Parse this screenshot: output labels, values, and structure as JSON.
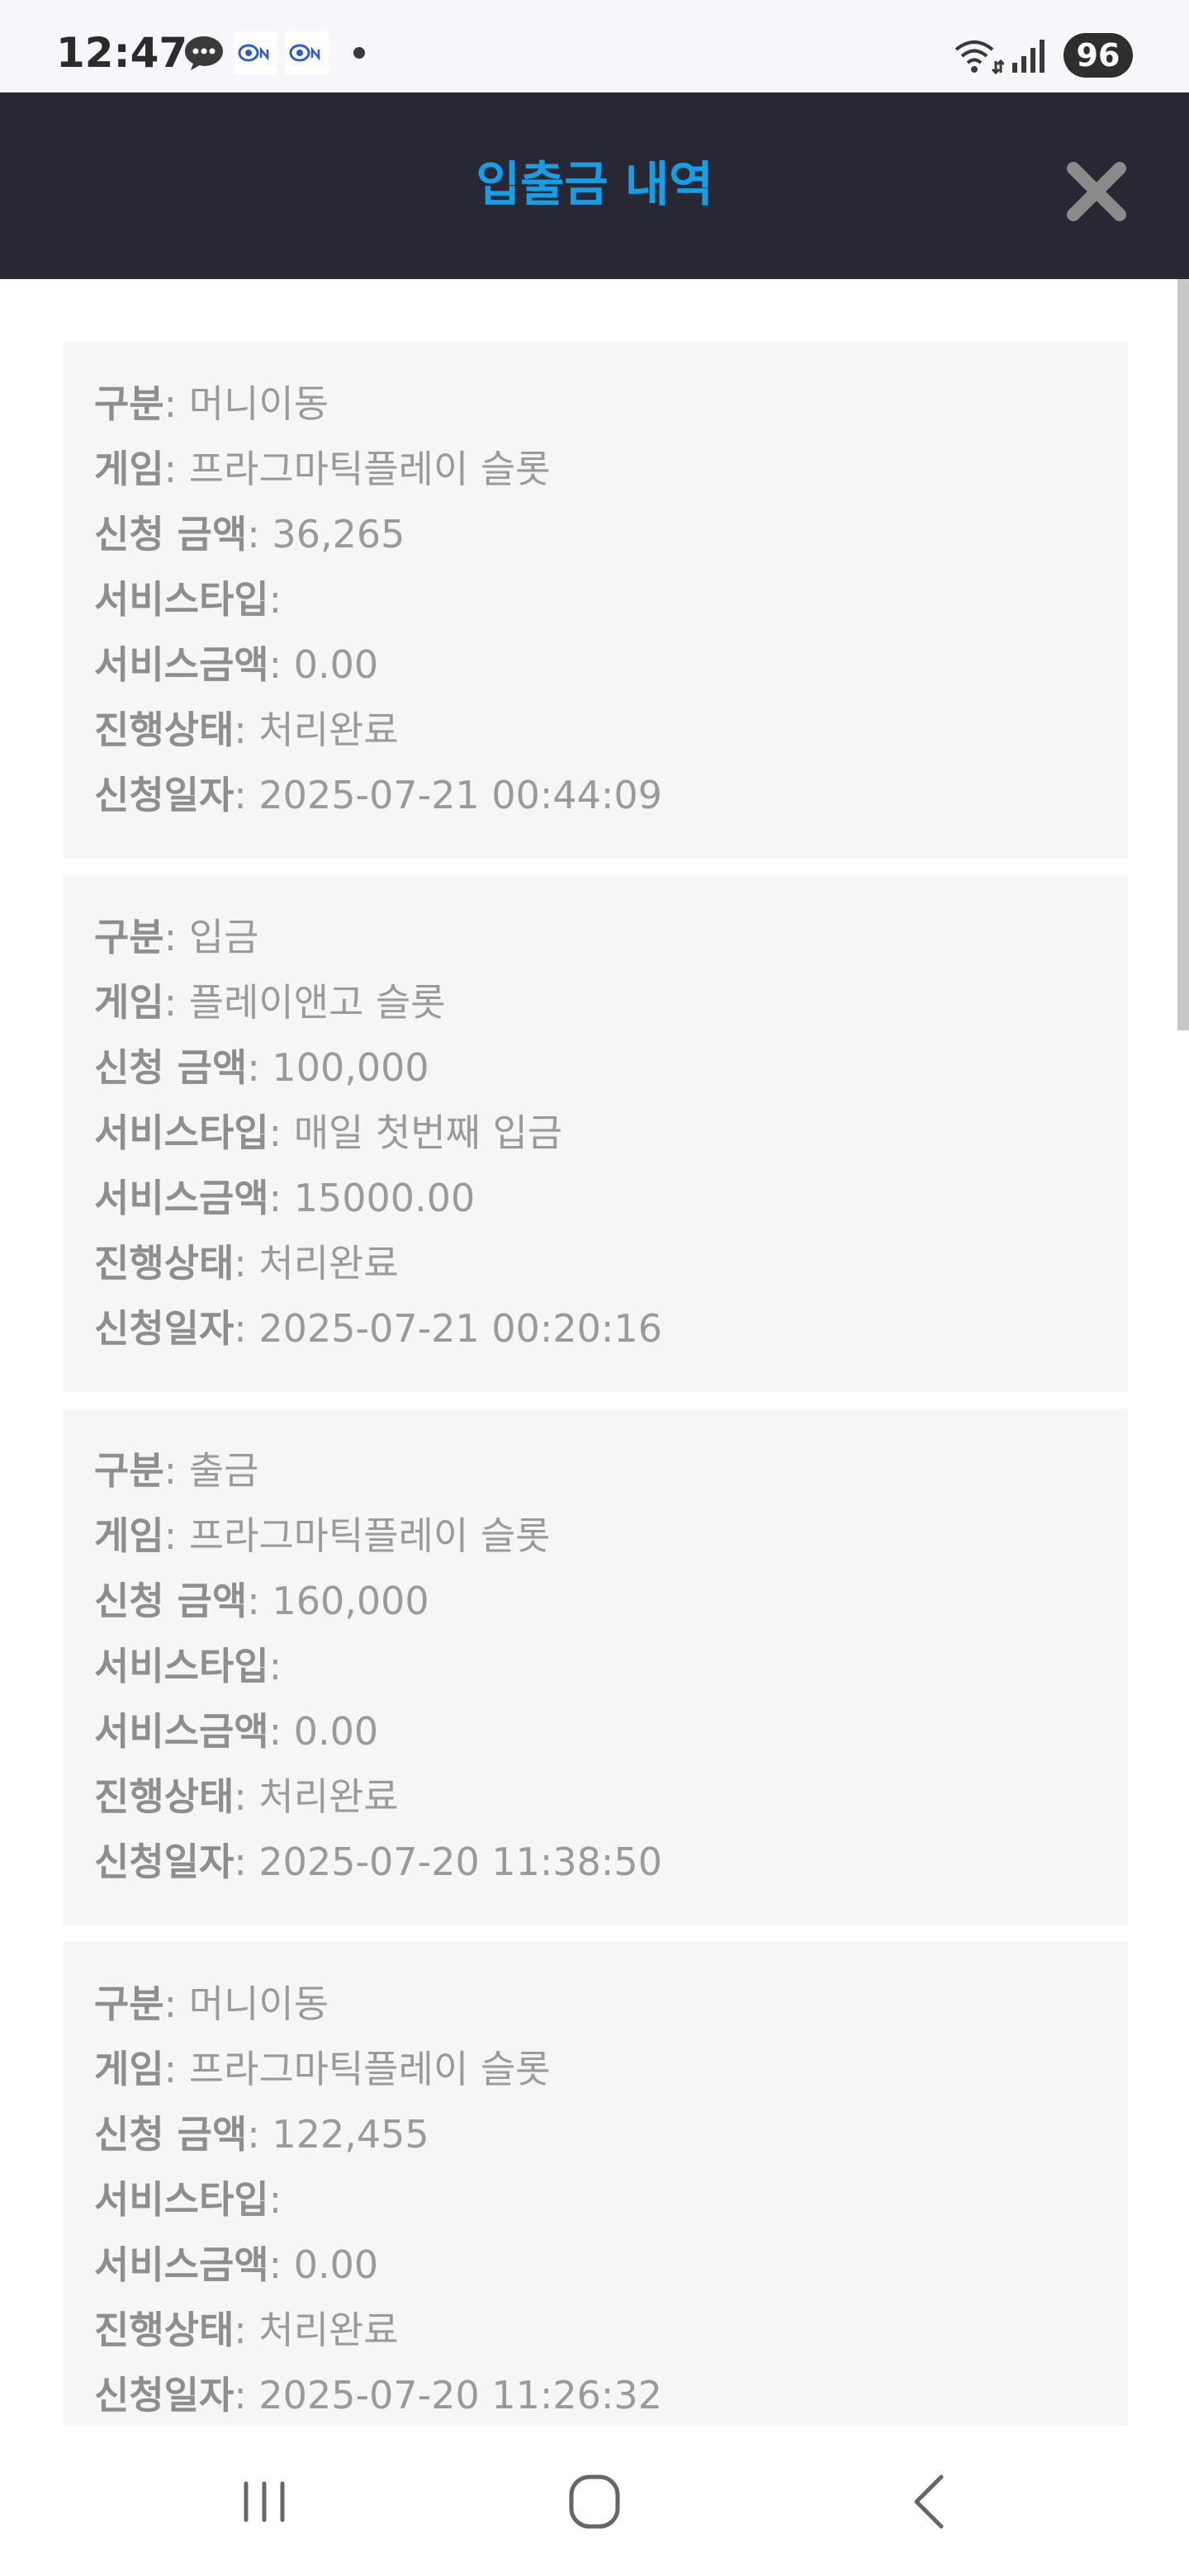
{
  "status_bar": {
    "time": "12:47",
    "battery": "96",
    "icons": [
      "chat-bubble-icon",
      "app-notification-icon",
      "app-notification-icon",
      "dot-icon",
      "wifi-icon",
      "signal-icon",
      "battery-icon"
    ]
  },
  "header": {
    "title": "입출금 내역",
    "close_icon": "close-x-icon",
    "title_color": "#14a0e8",
    "background": "#272833"
  },
  "records": [
    {
      "category_label": "구분",
      "category": "머니이동",
      "game_label": "게임",
      "game": "프라그마틱플레이 슬롯",
      "amount_label": "신청 금액",
      "amount": "36,265",
      "service_type_label": "서비스타입",
      "service_type": "",
      "service_amount_label": "서비스금액",
      "service_amount": "0.00",
      "status_label": "진행상태",
      "status": "처리완료",
      "date_label": "신청일자",
      "date": "2025-07-21 00:44:09"
    },
    {
      "category_label": "구분",
      "category": "입금",
      "game_label": "게임",
      "game": "플레이앤고 슬롯",
      "amount_label": "신청 금액",
      "amount": "100,000",
      "service_type_label": "서비스타입",
      "service_type": "매일 첫번째 입금",
      "service_amount_label": "서비스금액",
      "service_amount": "15000.00",
      "status_label": "진행상태",
      "status": "처리완료",
      "date_label": "신청일자",
      "date": "2025-07-21 00:20:16"
    },
    {
      "category_label": "구분",
      "category": "출금",
      "game_label": "게임",
      "game": "프라그마틱플레이 슬롯",
      "amount_label": "신청 금액",
      "amount": "160,000",
      "service_type_label": "서비스타입",
      "service_type": "",
      "service_amount_label": "서비스금액",
      "service_amount": "0.00",
      "status_label": "진행상태",
      "status": "처리완료",
      "date_label": "신청일자",
      "date": "2025-07-20 11:38:50"
    },
    {
      "category_label": "구분",
      "category": "머니이동",
      "game_label": "게임",
      "game": "프라그마틱플레이 슬롯",
      "amount_label": "신청 금액",
      "amount": "122,455",
      "service_type_label": "서비스타입",
      "service_type": "",
      "service_amount_label": "서비스금액",
      "service_amount": "0.00",
      "status_label": "진행상태",
      "status": "처리완료",
      "date_label": "신청일자",
      "date": "2025-07-20 11:26:32"
    }
  ],
  "nav_bar": {
    "icons": [
      "recent-apps-icon",
      "home-icon",
      "back-icon"
    ]
  }
}
